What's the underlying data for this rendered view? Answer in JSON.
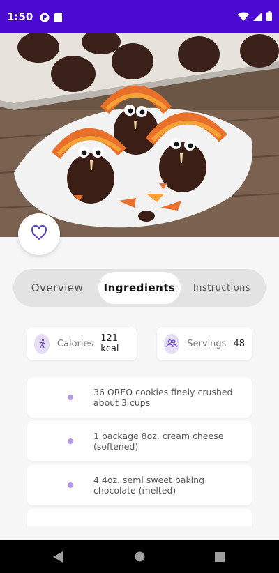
{
  "status_bar": {
    "time": "1:50"
  },
  "tabs": [
    {
      "label": "Overview"
    },
    {
      "label": "Ingredients"
    },
    {
      "label": "Instructions"
    }
  ],
  "stats": {
    "calories": {
      "label": "Calories",
      "value": "121 kcal"
    },
    "servings": {
      "label": "Servings",
      "value": "48"
    }
  },
  "ingredients": [
    {
      "text": "36 OREO cookies finely crushed about 3 cups"
    },
    {
      "text": "1 package 8oz. cream cheese (softened)"
    },
    {
      "text": "4 4oz. semi sweet baking chocolate (melted)"
    },
    {
      "text": ""
    }
  ],
  "colors": {
    "status_bar": "#4a0ad0",
    "accent": "#5a3fc0",
    "icon_bg": "#e6dcf4",
    "bullet": "#b49ae8"
  },
  "icons": {
    "favorite": "heart-outline-icon",
    "calories": "running-icon",
    "servings": "people-icon"
  }
}
